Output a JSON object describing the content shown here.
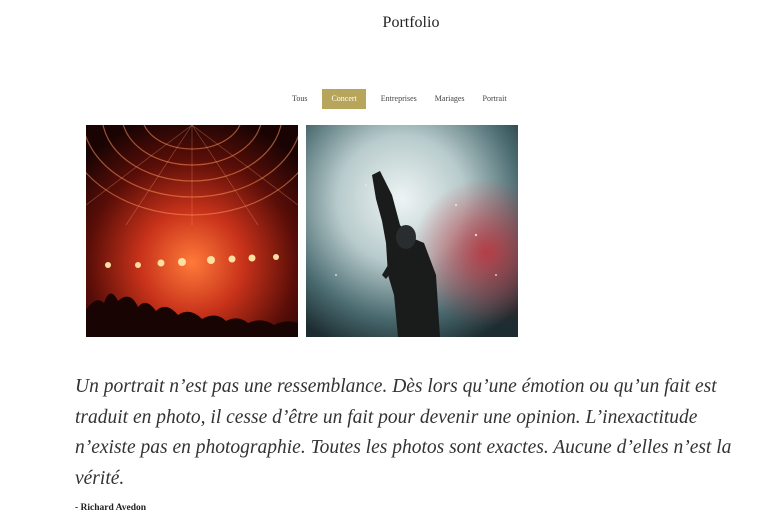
{
  "page": {
    "title": "Portfolio"
  },
  "filters": [
    {
      "label": "Tous",
      "active": false
    },
    {
      "label": "Concert",
      "active": true
    },
    {
      "label": "Entreprises",
      "active": false
    },
    {
      "label": "Mariages",
      "active": false
    },
    {
      "label": "Portrait",
      "active": false
    }
  ],
  "colors": {
    "accent": "#b8a55c"
  },
  "quote": {
    "text": "Un portrait n’est pas une ressemblance. Dès lors qu’une émotion ou qu’un fait est traduit en photo, il cesse d’être un fait pour devenir une opinion. L’inexactitude n’existe pas en photographie. Toutes les photos sont exactes. Aucune d’elles n’est la vérité.",
    "author": "- Richard Avedon"
  }
}
